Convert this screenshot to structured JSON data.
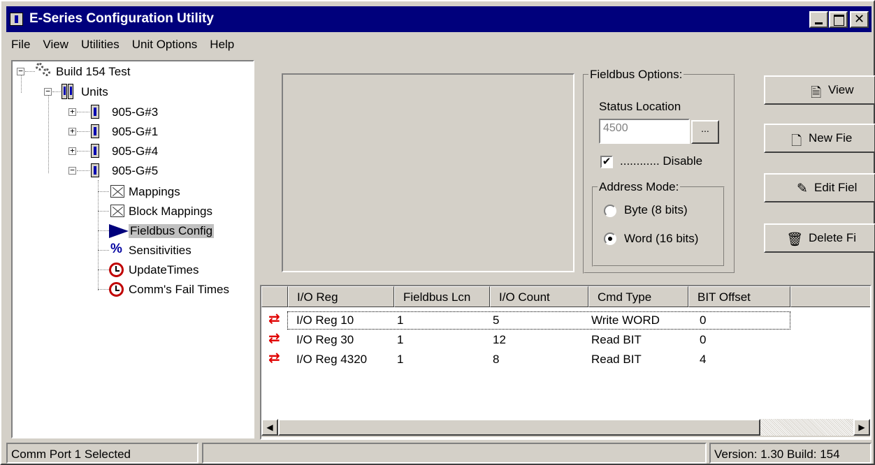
{
  "window": {
    "title": "E-Series Configuration Utility",
    "close_glyph": "✕"
  },
  "menu": [
    "File",
    "View",
    "Utilities",
    "Unit Options",
    "Help"
  ],
  "tree": {
    "root": "Build 154 Test",
    "units": "Units",
    "unit_items": [
      "905-G#3",
      "905-G#1",
      "905-G#4",
      "905-G#5"
    ],
    "children": [
      "Mappings",
      "Block Mappings",
      "Fieldbus Config",
      "Sensitivities",
      "UpdateTimes",
      "Comm's Fail Times"
    ],
    "selected": "Fieldbus Config",
    "pct_glyph": "%",
    "expand_glyph": "+",
    "collapse_glyph": "−"
  },
  "fieldbus_options": {
    "title": "Fieldbus Options:",
    "status_location_label": "Status Location",
    "status_location_value": "4500",
    "browse_label": "...",
    "disable_label": "............ Disable",
    "disable_checked": true,
    "check_glyph": "✔",
    "address_mode": {
      "title": "Address Mode:",
      "options": [
        "Byte (8 bits)",
        "Word (16 bits)"
      ],
      "selected": "Word (16 bits)"
    }
  },
  "side_buttons": [
    {
      "label": "View",
      "icon": "document-icon",
      "glyph": "🗎"
    },
    {
      "label": "New Fie",
      "icon": "new-document-icon",
      "glyph": "🗋"
    },
    {
      "label": "Edit Fiel",
      "icon": "edit-icon",
      "glyph": "✎"
    },
    {
      "label": "Delete Fi",
      "icon": "trash-icon",
      "glyph": "🗑"
    }
  ],
  "grid": {
    "headers": [
      "I/O Reg",
      "Fieldbus Lcn",
      "I/O Count",
      "Cmd Type",
      "BIT Offset"
    ],
    "row_icon": "⇄",
    "rows": [
      [
        "I/O Reg 10",
        "1",
        "5",
        "Write WORD",
        "0"
      ],
      [
        "I/O Reg 30",
        "1",
        "12",
        "Read BIT",
        "0"
      ],
      [
        "I/O Reg 4320",
        "1",
        "8",
        "Read BIT",
        "4"
      ]
    ],
    "scroll_left_glyph": "◀",
    "scroll_right_glyph": "▶"
  },
  "status": {
    "left": "Comm Port 1 Selected",
    "middle": "",
    "right": "Version: 1.30 Build: 154"
  },
  "colors": {
    "title_bar": "#00007c",
    "face": "#d4d0c8",
    "sync_icon": "#e00000",
    "selection": "#c0c0c0"
  }
}
